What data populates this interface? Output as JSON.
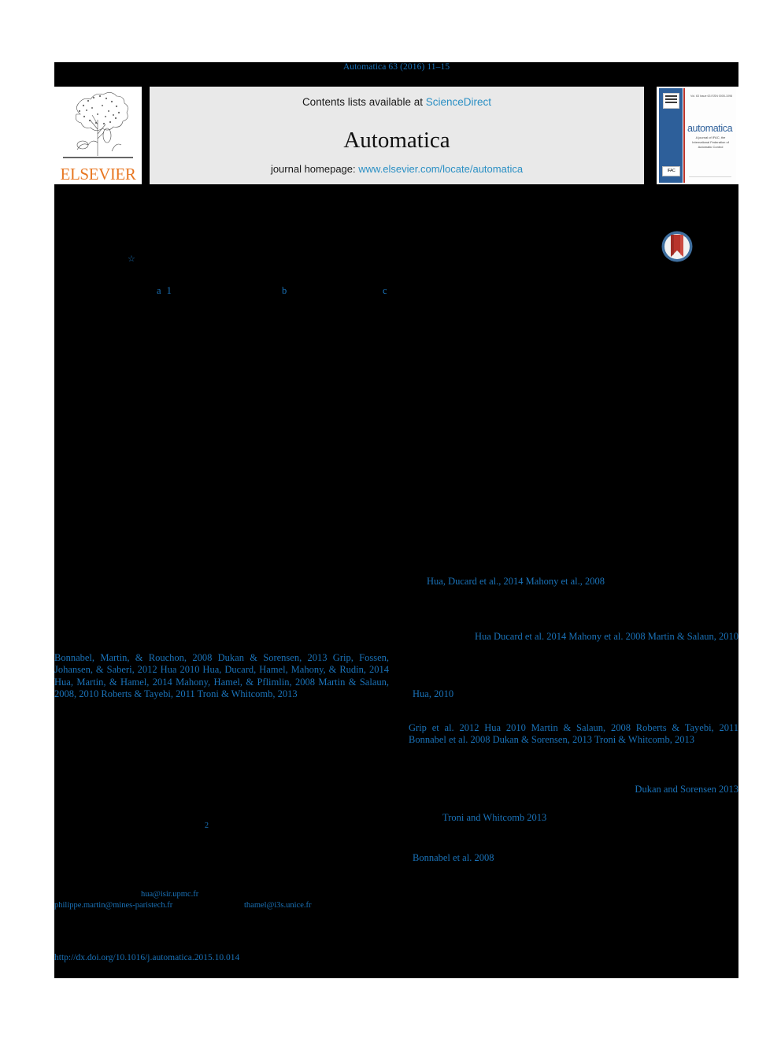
{
  "document": {
    "type": "journal-article-first-page",
    "running_head": "Automatica 63 (2016) 11–15"
  },
  "masthead": {
    "publisher_logo_label": "ELSEVIER",
    "contents_prefix": "Contents lists available at ",
    "contents_link": "ScienceDirect",
    "journal_name": "Automatica",
    "homepage_prefix": "journal homepage: ",
    "homepage_link": "www.elsevier.com/locate/automatica",
    "cover": {
      "title": "automatica",
      "subtitle": "A journal of IFAC, the International Federation of Automatic Control",
      "top_meta": [
        "Vol. 63",
        "Issue 63",
        "ISSN 0005-1098"
      ],
      "badge": "IFAC"
    },
    "crossmark_label": "CrossMark"
  },
  "affiliation_markers": {
    "title_footnote": "☆",
    "author_a": "a 1",
    "author_b": "b",
    "author_c": "c"
  },
  "citations": {
    "right_col_1": "Hua, Ducard et al., 2014          Mahony et al., 2008",
    "right_col_2": "Hua  Ducard et al.  2014\nMahony  et  al.   2008   Martin  &  Salaun,  2010",
    "right_col_3": "Hua,  2010",
    "right_col_4": "Grip et al.  2012  Hua  2010  Martin & Salaun, 2008  Roberts & Tayebi, 2011                                Bonnabel et al.  2008  Dukan & Sorensen, 2013   Troni & Whitcomb, 2013",
    "right_col_5": "Dukan and Sorensen\n2013",
    "right_col_6": "Troni and Whitcomb  2013",
    "right_col_7": "Bonnabel et al.   2008",
    "left_col_1": "Bonnabel, Martin, & Rouchon, 2008  Dukan & Sorensen, 2013  Grip, Fossen, Johansen, & Saberi, 2012  Hua  2010  Hua, Ducard, Hamel, Mahony, & Rudin, 2014  Hua, Martin, & Hamel, 2014  Mahony, Hamel, & Pflimlin, 2008  Martin & Salaun, 2008, 2010   Roberts & Tayebi, 2011   Troni & Whitcomb, 2013",
    "left_footnote_marker": "2"
  },
  "footer": {
    "email_1": "hua@isir.upmc.fr",
    "email_2": "philippe.martin@mines-paristech.fr",
    "email_3": "thamel@i3s.unice.fr",
    "doi": "http://dx.doi.org/10.1016/j.automatica.2015.10.014"
  },
  "colors": {
    "link_blue": "#1a72b8",
    "sciencedirect_blue": "#2a8fc4",
    "elsevier_orange": "#e87722",
    "band_gray": "#e9e9e9",
    "page_black": "#000000",
    "cover_blue": "#2d5f9a",
    "crossmark_red": "#b8342c"
  }
}
